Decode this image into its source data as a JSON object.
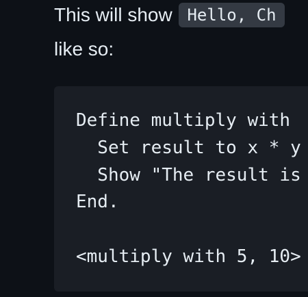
{
  "paragraph": {
    "text_before_code": "This will show ",
    "inline_code": "Hello, Ch",
    "continuation": "like so:"
  },
  "code_block": {
    "lines": [
      "Define multiply with",
      "  Set result to x * y",
      "  Show \"The result is",
      "End.",
      "",
      "<multiply with 5, 10>"
    ]
  }
}
